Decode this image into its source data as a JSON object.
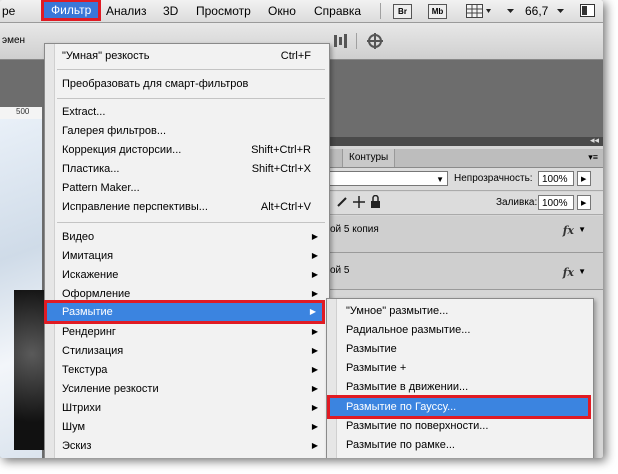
{
  "menubar": {
    "items": [
      {
        "label": "ре"
      },
      {
        "label": "Фильтр"
      },
      {
        "label": "Анализ"
      },
      {
        "label": "3D"
      },
      {
        "label": "Просмотр"
      },
      {
        "label": "Окно"
      },
      {
        "label": "Справка"
      }
    ],
    "br_label": "Br",
    "mb_label": "Mb",
    "zoom": "66,7"
  },
  "options": {
    "left_text": "эмен"
  },
  "ruler": {
    "value": "500"
  },
  "panel": {
    "tab_label": "Контуры",
    "opacity_label": "Непрозрачность:",
    "opacity_value": "100%",
    "fill_label": "Заливка:",
    "fill_value": "100%",
    "layers": [
      {
        "name": "ой 5 копия",
        "fx": "fx"
      },
      {
        "name": "ой 5",
        "fx": "fx"
      }
    ]
  },
  "filter_menu": {
    "items": [
      {
        "label": "\"Умная\" резкость",
        "shortcut": "Ctrl+F"
      },
      {
        "label": "Преобразовать для смарт-фильтров",
        "shortcut": ""
      },
      {
        "label": "Extract...",
        "shortcut": ""
      },
      {
        "label": "Галерея фильтров...",
        "shortcut": ""
      },
      {
        "label": "Коррекция дисторсии...",
        "shortcut": "Shift+Ctrl+R"
      },
      {
        "label": "Пластика...",
        "shortcut": "Shift+Ctrl+X"
      },
      {
        "label": "Pattern Maker...",
        "shortcut": ""
      },
      {
        "label": "Исправление перспективы...",
        "shortcut": "Alt+Ctrl+V"
      },
      {
        "label": "Видео"
      },
      {
        "label": "Имитация"
      },
      {
        "label": "Искажение"
      },
      {
        "label": "Оформление"
      },
      {
        "label": "Размытие"
      },
      {
        "label": "Рендеринг"
      },
      {
        "label": "Стилизация"
      },
      {
        "label": "Текстура"
      },
      {
        "label": "Усиление резкости"
      },
      {
        "label": "Штрихи"
      },
      {
        "label": "Шум"
      },
      {
        "label": "Эскиз"
      }
    ],
    "submenu_arrow": "▶"
  },
  "blur_submenu": {
    "items": [
      {
        "label": "\"Умное\" размытие..."
      },
      {
        "label": "Радиальное размытие..."
      },
      {
        "label": "Размытие"
      },
      {
        "label": "Размытие +"
      },
      {
        "label": "Размытие в движении..."
      },
      {
        "label": "Размытие по Гауссу..."
      },
      {
        "label": "Размытие по поверхности..."
      },
      {
        "label": "Размытие по рамке..."
      }
    ]
  },
  "colors": {
    "highlight": "#3b84e0",
    "marker": "#e01b24"
  }
}
